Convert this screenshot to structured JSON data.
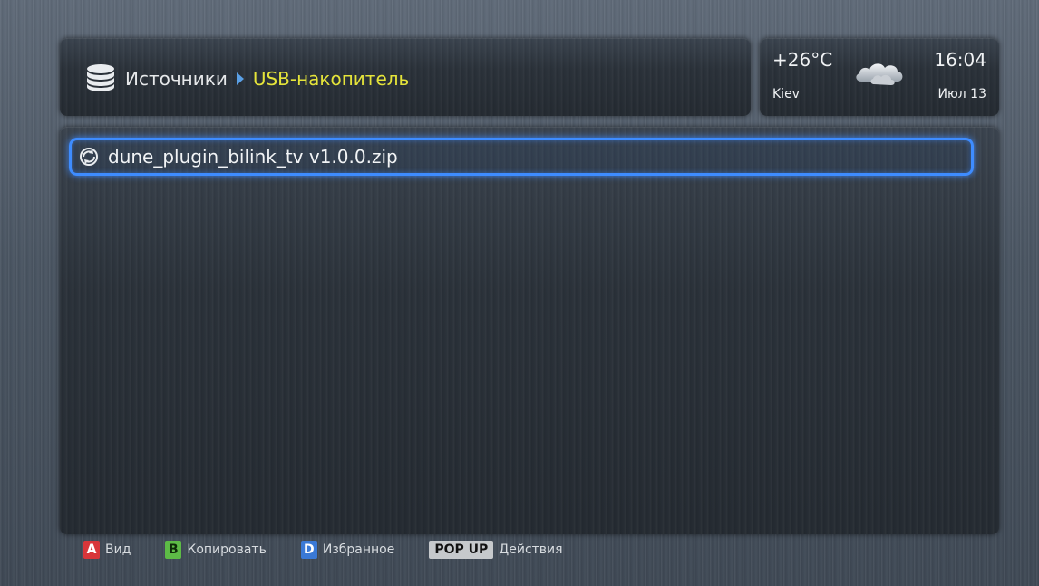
{
  "header": {
    "breadcrumb": {
      "root": "Источники",
      "current": "USB-накопитель"
    },
    "icon": "database-icon"
  },
  "weather": {
    "temperature": "+26°C",
    "city": "Kiev",
    "time": "16:04",
    "date": "Июл 13",
    "icon": "cloud-icon"
  },
  "files": [
    {
      "name": "dune_plugin_bilink_tv v1.0.0.zip",
      "icon": "update-icon",
      "selected": true
    }
  ],
  "footer": {
    "hints": [
      {
        "key": "A",
        "label": "Вид",
        "color": "#d8363a"
      },
      {
        "key": "B",
        "label": "Копировать",
        "color": "#5dbb46"
      },
      {
        "key": "D",
        "label": "Избранное",
        "color": "#3a79d6"
      },
      {
        "key": "POP UP",
        "label": "Действия",
        "color": "#c6c9cc"
      }
    ]
  },
  "colors": {
    "accent": "#3e8cff",
    "breadcrumb_current": "#e5e43a"
  }
}
